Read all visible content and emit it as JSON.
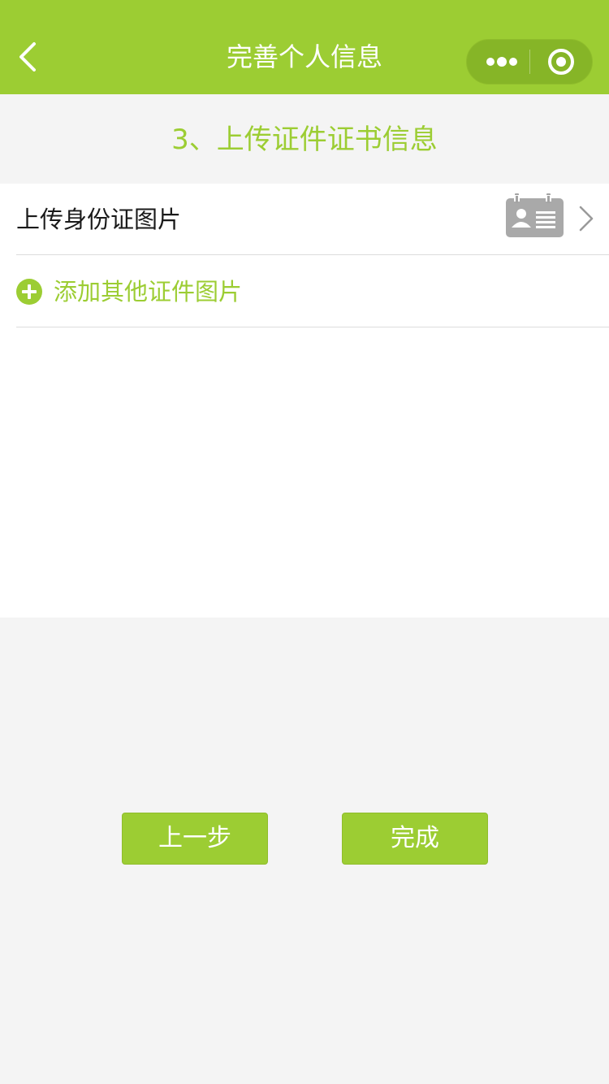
{
  "nav": {
    "title": "完善个人信息",
    "icons": {
      "back": "chevron-left-icon",
      "more": "more-dots-icon",
      "close": "target-icon"
    },
    "colors": {
      "bar": "#9ccd33",
      "capsule": "#86b527"
    }
  },
  "section": {
    "title": "3、上传证件证书信息",
    "color": "#9ccd33"
  },
  "list": {
    "id_upload": {
      "label": "上传身份证图片",
      "icon": "id-card-icon"
    },
    "add_other": {
      "label": "添加其他证件图片",
      "icon": "plus-circle-icon"
    }
  },
  "actions": {
    "prev_label": "上一步",
    "done_label": "完成",
    "color": "#9ccd33"
  }
}
